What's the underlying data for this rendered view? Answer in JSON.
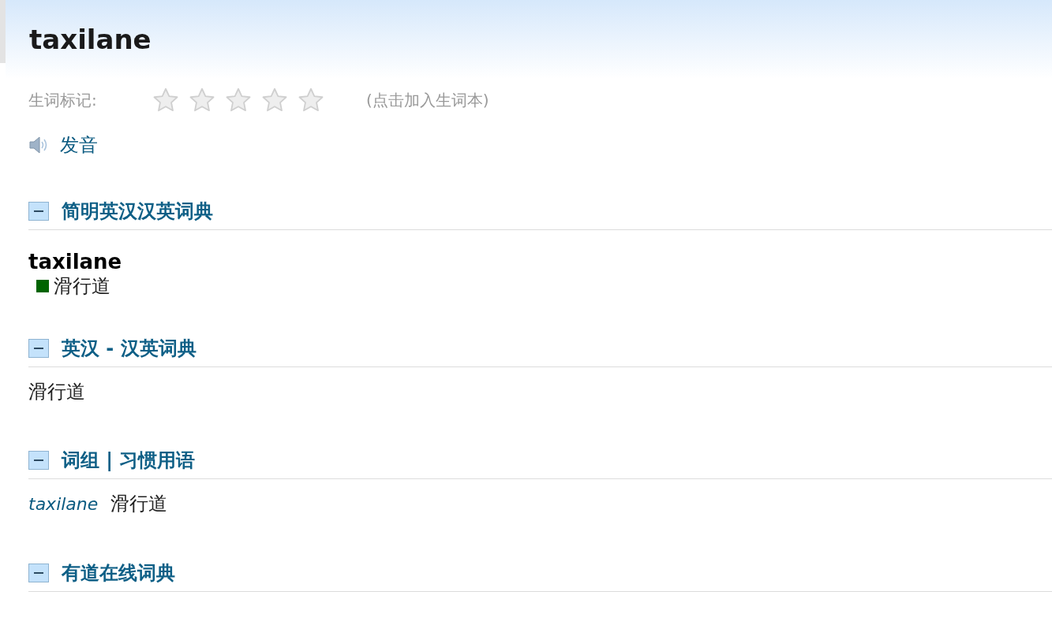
{
  "header": {
    "word": "taxilane"
  },
  "wordbook": {
    "label": "生词标记:",
    "stars": 0,
    "hint": "(点击加入生词本)"
  },
  "pronounce": {
    "label": "发音"
  },
  "sections": [
    {
      "title": "简明英汉汉英词典",
      "expanded": true,
      "kind": "entry",
      "headword": "taxilane",
      "definitions": [
        "滑行道"
      ]
    },
    {
      "title": "英汉 - 汉英词典",
      "expanded": true,
      "kind": "plain",
      "text": "滑行道"
    },
    {
      "title": "词组 | 习惯用语",
      "expanded": true,
      "kind": "phrase",
      "phrase": "taxilane",
      "meaning": "滑行道"
    },
    {
      "title": "有道在线词典",
      "expanded": true,
      "kind": "none"
    }
  ]
}
